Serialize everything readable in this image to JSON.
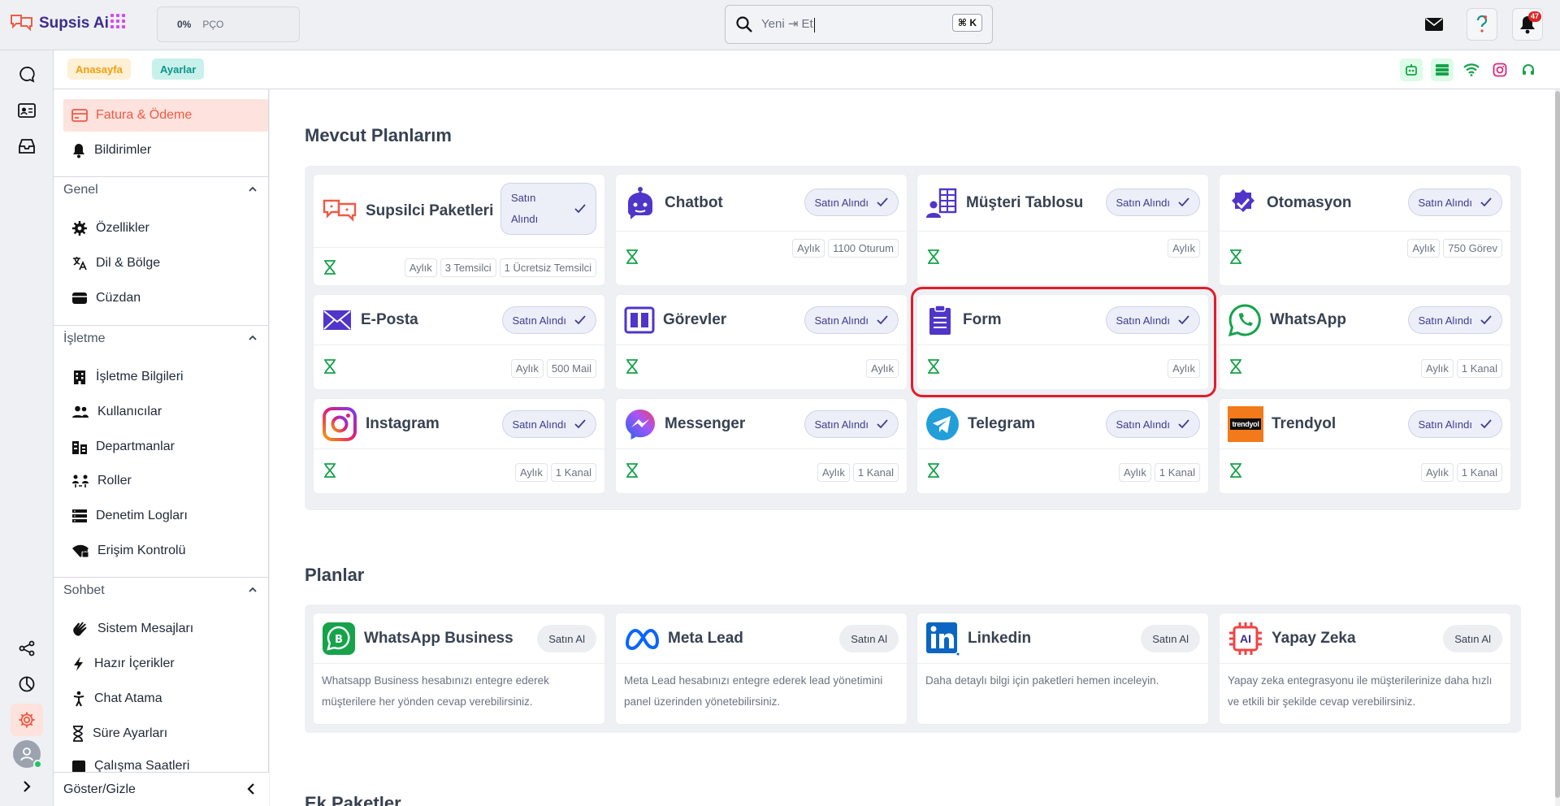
{
  "app": {
    "name": "Supsis Ai"
  },
  "topbar": {
    "progress_value": "0%",
    "progress_label": "PÇO",
    "search_value": "Yeni ⇥ Et",
    "search_shortcut": "⌘ K",
    "notification_count": "47"
  },
  "breadcrumb": {
    "home": "Anasayfa",
    "current": "Ayarlar"
  },
  "sidebar": {
    "top_items": [
      "Fatura & Ödeme",
      "Bildirimler"
    ],
    "sections": [
      {
        "title": "Genel",
        "items": [
          "Özellikler",
          "Dil & Bölge",
          "Cüzdan"
        ]
      },
      {
        "title": "İşletme",
        "items": [
          "İşletme Bilgileri",
          "Kullanıcılar",
          "Departmanlar",
          "Roller",
          "Denetim Logları",
          "Erişim Kontrolü"
        ]
      },
      {
        "title": "Sohbet",
        "items": [
          "Sistem Mesajları",
          "Hazır İçerikler",
          "Chat Atama",
          "Süre Ayarları",
          "Çalışma Saatleri"
        ]
      }
    ],
    "footer": "Göster/Gizle"
  },
  "main": {
    "current_title": "Mevcut Planlarım",
    "plans_title": "Planlar",
    "extra_title": "Ek Paketler",
    "purchased_label": "Satın Alındı",
    "purchased_label_wrapped": [
      "Satın",
      "Alındı"
    ],
    "buy_label": "Satın Al",
    "current_plans": [
      {
        "name": "Supsilci Paketleri",
        "tags": [
          "Aylık",
          "3 Temsilci",
          "1 Ücretsiz Temsilci"
        ]
      },
      {
        "name": "Chatbot",
        "tags": [
          "Aylık",
          "1100 Oturum"
        ]
      },
      {
        "name": "Müşteri Tablosu",
        "tags": [
          "Aylık"
        ]
      },
      {
        "name": "Otomasyon",
        "tags": [
          "Aylık",
          "750 Görev"
        ]
      },
      {
        "name": "E-Posta",
        "tags": [
          "Aylık",
          "500 Mail"
        ]
      },
      {
        "name": "Görevler",
        "tags": [
          "Aylık"
        ]
      },
      {
        "name": "Form",
        "tags": [
          "Aylık"
        ]
      },
      {
        "name": "WhatsApp",
        "tags": [
          "Aylık",
          "1 Kanal"
        ]
      },
      {
        "name": "Instagram",
        "tags": [
          "Aylık",
          "1 Kanal"
        ]
      },
      {
        "name": "Messenger",
        "tags": [
          "Aylık",
          "1 Kanal"
        ]
      },
      {
        "name": "Telegram",
        "tags": [
          "Aylık",
          "1 Kanal"
        ]
      },
      {
        "name": "Trendyol",
        "tags": [
          "Aylık",
          "1 Kanal"
        ]
      }
    ],
    "trendyol_logo_text": "trendyol",
    "ai_logo_text": "AI",
    "plans": [
      {
        "name": "WhatsApp Business",
        "desc": "Whatsapp Business hesabınızı entegre ederek müşterilere her yönden cevap verebilirsiniz."
      },
      {
        "name": "Meta Lead",
        "desc": "Meta Lead hesabınızı entegre ederek lead yönetimini panel üzerinden yönetebilirsiniz."
      },
      {
        "name": "Linkedin",
        "desc": "Daha detaylı bilgi için paketleri hemen inceleyin."
      },
      {
        "name": "Yapay Zeka",
        "desc": "Yapay zeka entegrasyonu ile müşterilerinize daha hızlı ve etkili bir şekilde cevap verebilirsiniz."
      }
    ]
  },
  "colors": {
    "accent": "#ef5a44",
    "purple": "#4f35c9",
    "green": "#16a34a",
    "highlight": "#e11d2a"
  }
}
